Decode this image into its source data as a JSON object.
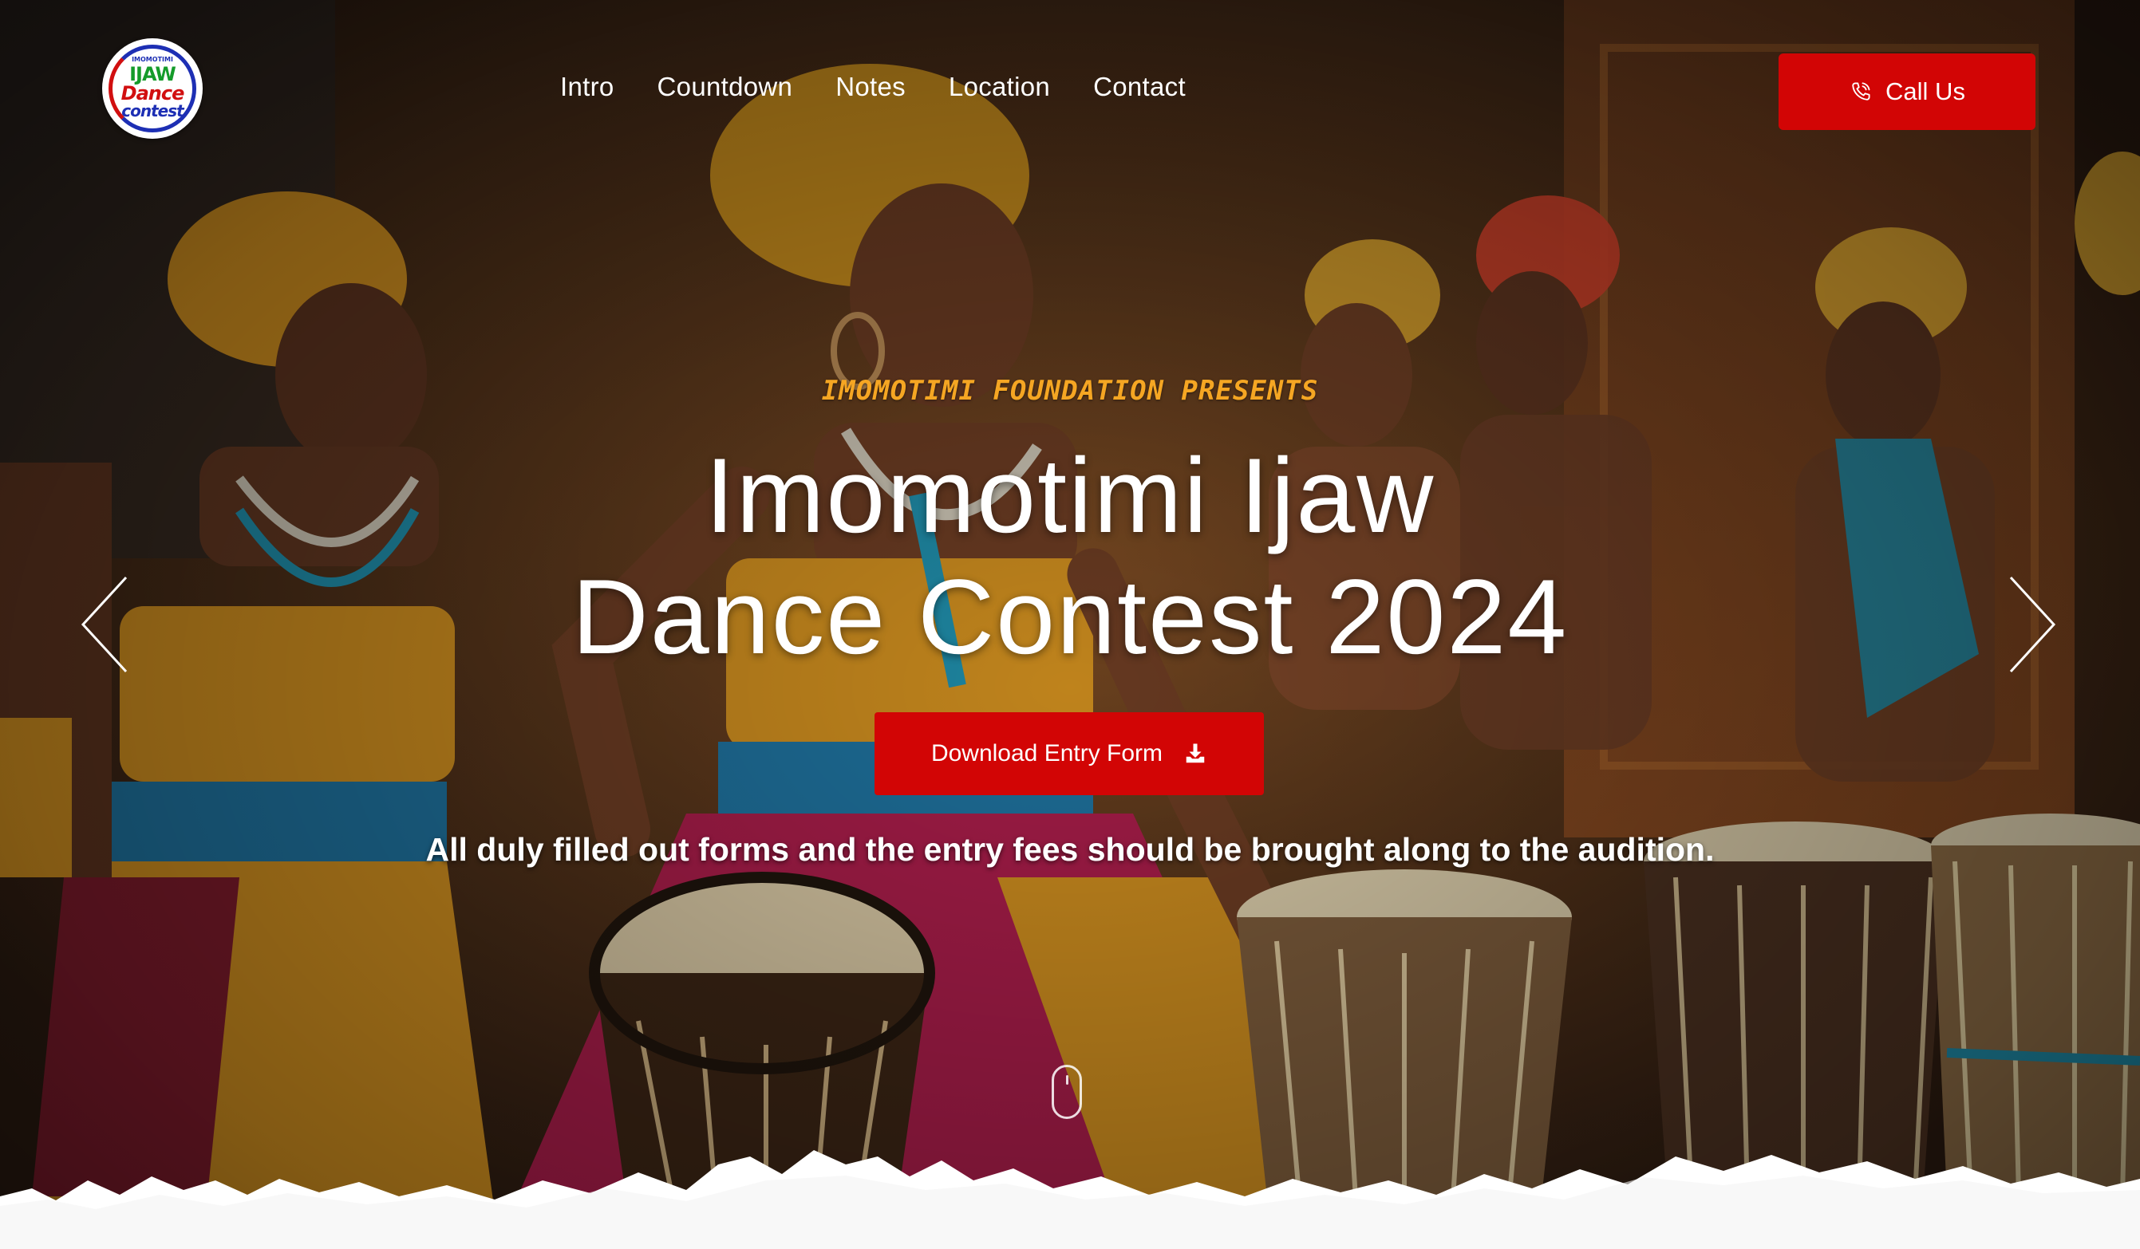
{
  "logo": {
    "line1": "IMOMOTIMI",
    "line2": "IJAW",
    "line3": "Dance",
    "line4": "contest"
  },
  "nav": {
    "items": [
      {
        "label": "Intro"
      },
      {
        "label": "Countdown"
      },
      {
        "label": "Notes"
      },
      {
        "label": "Location"
      },
      {
        "label": "Contact"
      }
    ]
  },
  "call_button": {
    "label": "Call Us",
    "icon": "phone-icon"
  },
  "hero": {
    "kicker": "IMOMOTIMI FOUNDATION PRESENTS",
    "title_line1": "Imomotimi Ijaw",
    "title_line2": "Dance Contest 2024",
    "download_label": "Download Entry Form",
    "download_icon": "download-icon",
    "note": "All duly filled out forms and the entry fees should be brought along to the audition."
  },
  "carousel": {
    "prev_icon": "chevron-left-icon",
    "next_icon": "chevron-right-icon"
  },
  "colors": {
    "accent": "#d20505",
    "kicker": "#f5a623"
  }
}
